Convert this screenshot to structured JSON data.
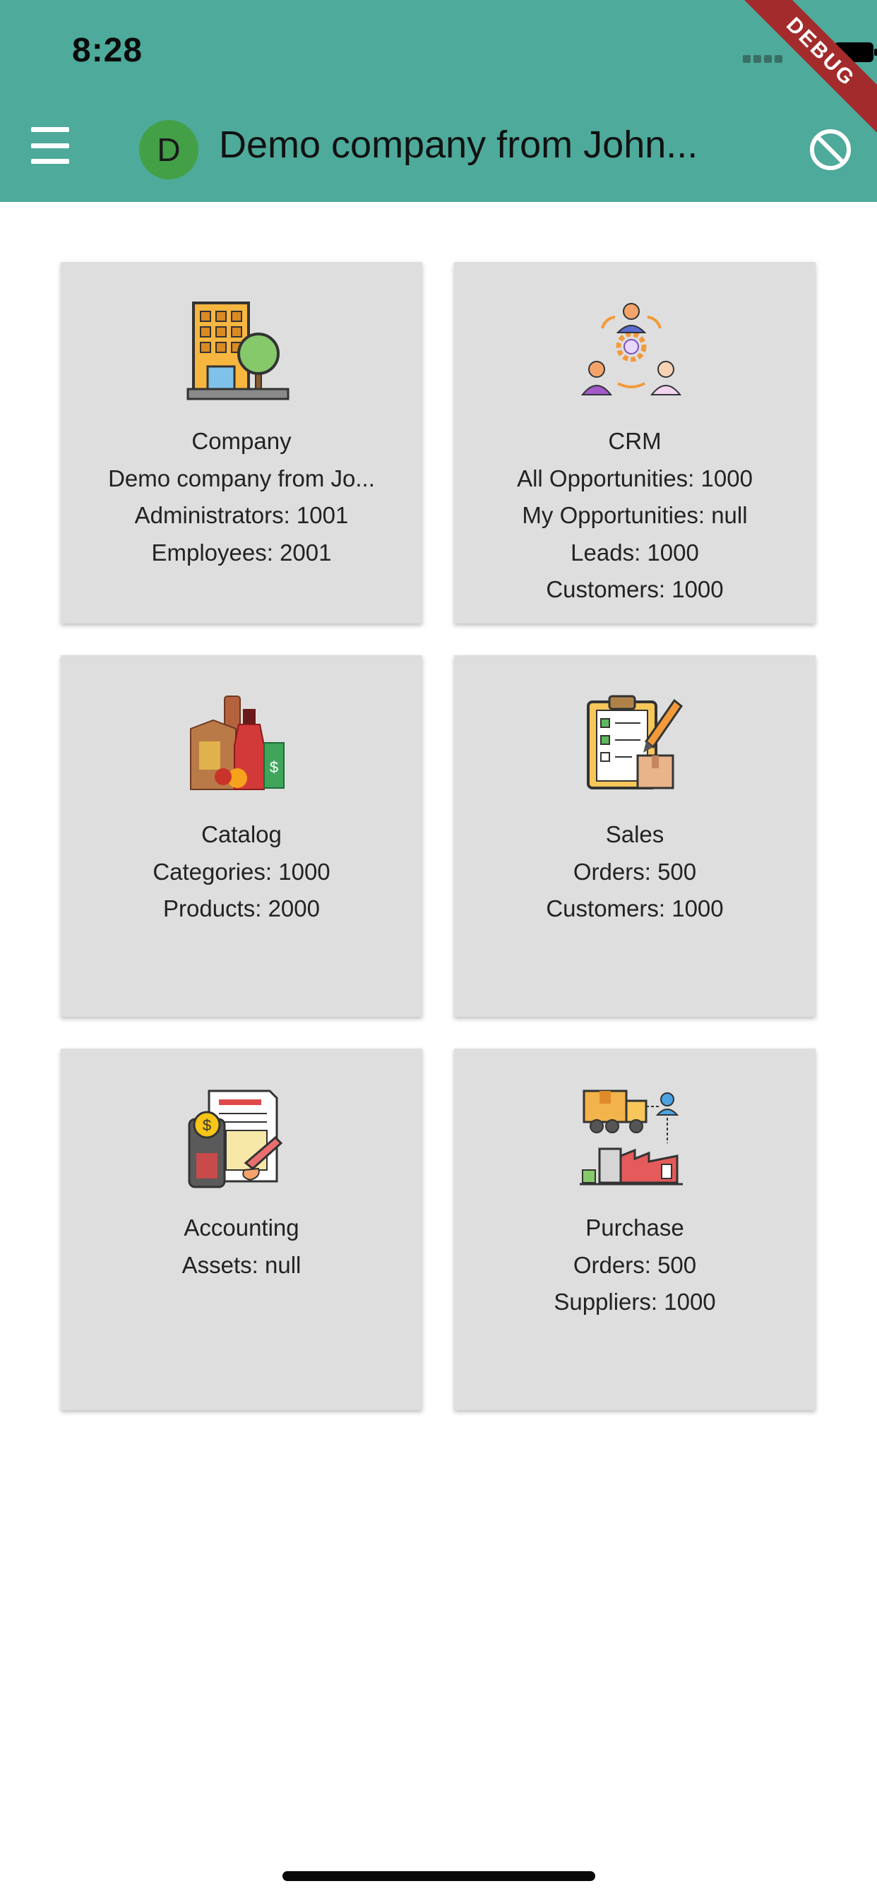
{
  "status": {
    "time": "8:28"
  },
  "debug_banner": "DEBUG",
  "header": {
    "avatar_letter": "D",
    "title": "Demo company from John..."
  },
  "cards": [
    {
      "name": "company",
      "icon": "building-tree-icon",
      "lines": [
        "Company",
        "Demo company from Jo...",
        "Administrators: 1001",
        "Employees: 2001"
      ]
    },
    {
      "name": "crm",
      "icon": "crm-people-gear-icon",
      "lines": [
        "CRM",
        "All Opportunities: 1000",
        "My Opportunities: null",
        "Leads: 1000",
        "Customers: 1000"
      ]
    },
    {
      "name": "catalog",
      "icon": "products-catalog-icon",
      "lines": [
        "Catalog",
        "Categories: 1000",
        "Products: 2000"
      ]
    },
    {
      "name": "sales",
      "icon": "clipboard-pencil-box-icon",
      "lines": [
        "Sales",
        "Orders: 500",
        "Customers: 1000"
      ]
    },
    {
      "name": "accounting",
      "icon": "calculator-document-icon",
      "lines": [
        "Accounting",
        "Assets: null"
      ]
    },
    {
      "name": "purchase",
      "icon": "truck-factory-icon",
      "lines": [
        "Purchase",
        "Orders: 500",
        "Suppliers: 1000"
      ]
    }
  ],
  "colors": {
    "appbar": "#4eaa9a",
    "card": "#dedede",
    "avatar": "#43a047",
    "debug": "#a32b2b"
  }
}
